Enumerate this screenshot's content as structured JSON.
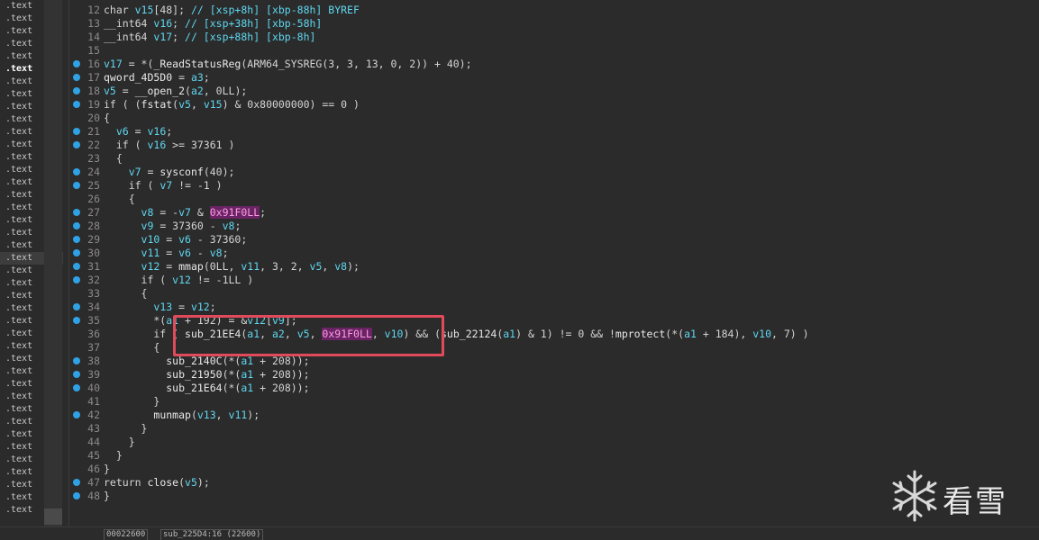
{
  "segments": [
    ".text",
    ".text",
    ".text",
    ".text",
    ".text",
    ".text",
    ".text",
    ".text",
    ".text",
    ".text",
    ".text",
    ".text",
    ".text",
    ".text",
    ".text",
    ".text",
    ".text",
    ".text",
    ".text",
    ".text",
    ".text",
    ".text",
    ".text",
    ".text",
    ".text",
    ".text",
    ".text",
    ".text",
    ".text",
    ".text",
    ".text",
    ".text",
    ".text",
    ".text",
    ".text",
    ".text",
    ".text",
    ".text",
    ".text",
    ".text",
    ".text"
  ],
  "code_lines": [
    {
      "n": "12",
      "bp": false,
      "tokens": [
        [
          "kw",
          "char "
        ],
        [
          "ident",
          "v15"
        ],
        [
          "kw",
          "[48]; "
        ],
        [
          "cmt",
          "// [xsp+8h] [xbp-88h] BYREF"
        ]
      ]
    },
    {
      "n": "13",
      "bp": false,
      "tokens": [
        [
          "kw",
          "__int64 "
        ],
        [
          "ident",
          "v16"
        ],
        [
          "kw",
          "; "
        ],
        [
          "cmt",
          "// [xsp+38h] [xbp-58h]"
        ]
      ]
    },
    {
      "n": "14",
      "bp": false,
      "tokens": [
        [
          "kw",
          "__int64 "
        ],
        [
          "ident",
          "v17"
        ],
        [
          "kw",
          "; "
        ],
        [
          "cmt",
          "// [xsp+88h] [xbp-8h]"
        ]
      ]
    },
    {
      "n": "15",
      "bp": false,
      "tokens": []
    },
    {
      "n": "16",
      "bp": true,
      "tokens": [
        [
          "ident",
          "v17"
        ],
        [
          "kw",
          " = *("
        ],
        [
          "func",
          "_ReadStatusReg"
        ],
        [
          "kw",
          "(ARM64_SYSREG(3, 3, 13, 0, 2)) + 40);"
        ]
      ]
    },
    {
      "n": "17",
      "bp": true,
      "tokens": [
        [
          "func",
          "qword_4D5D0"
        ],
        [
          "kw",
          " = "
        ],
        [
          "ident",
          "a3"
        ],
        [
          "kw",
          ";"
        ]
      ]
    },
    {
      "n": "18",
      "bp": true,
      "tokens": [
        [
          "ident",
          "v5"
        ],
        [
          "kw",
          " = "
        ],
        [
          "func",
          "__open_2"
        ],
        [
          "kw",
          "("
        ],
        [
          "ident",
          "a2"
        ],
        [
          "kw",
          ", 0LL);"
        ]
      ]
    },
    {
      "n": "19",
      "bp": true,
      "tokens": [
        [
          "kw",
          "if ( ("
        ],
        [
          "func",
          "fstat"
        ],
        [
          "kw",
          "("
        ],
        [
          "ident",
          "v5"
        ],
        [
          "kw",
          ", "
        ],
        [
          "ident",
          "v15"
        ],
        [
          "kw",
          ") & 0x80000000) == 0 )"
        ]
      ]
    },
    {
      "n": "20",
      "bp": false,
      "tokens": [
        [
          "kw",
          "{"
        ]
      ]
    },
    {
      "n": "21",
      "bp": true,
      "tokens": [
        [
          "kw",
          "  "
        ],
        [
          "ident",
          "v6"
        ],
        [
          "kw",
          " = "
        ],
        [
          "ident",
          "v16"
        ],
        [
          "kw",
          ";"
        ]
      ]
    },
    {
      "n": "22",
      "bp": true,
      "tokens": [
        [
          "kw",
          "  if ( "
        ],
        [
          "ident",
          "v16"
        ],
        [
          "kw",
          " >= 37361 )"
        ]
      ]
    },
    {
      "n": "23",
      "bp": false,
      "tokens": [
        [
          "kw",
          "  {"
        ]
      ]
    },
    {
      "n": "24",
      "bp": true,
      "tokens": [
        [
          "kw",
          "    "
        ],
        [
          "ident",
          "v7"
        ],
        [
          "kw",
          " = "
        ],
        [
          "func",
          "sysconf"
        ],
        [
          "kw",
          "(40);"
        ]
      ]
    },
    {
      "n": "25",
      "bp": true,
      "tokens": [
        [
          "kw",
          "    if ( "
        ],
        [
          "ident",
          "v7"
        ],
        [
          "kw",
          " != -1 )"
        ]
      ]
    },
    {
      "n": "26",
      "bp": false,
      "tokens": [
        [
          "kw",
          "    {"
        ]
      ]
    },
    {
      "n": "27",
      "bp": true,
      "tokens": [
        [
          "kw",
          "      "
        ],
        [
          "ident",
          "v8"
        ],
        [
          "kw",
          " = -"
        ],
        [
          "ident",
          "v7"
        ],
        [
          "kw",
          " & "
        ],
        [
          "hexnum",
          "0x91F0LL"
        ],
        [
          "kw",
          ";"
        ]
      ]
    },
    {
      "n": "28",
      "bp": true,
      "tokens": [
        [
          "kw",
          "      "
        ],
        [
          "ident",
          "v9"
        ],
        [
          "kw",
          " = 37360 - "
        ],
        [
          "ident",
          "v8"
        ],
        [
          "kw",
          ";"
        ]
      ]
    },
    {
      "n": "29",
      "bp": true,
      "tokens": [
        [
          "kw",
          "      "
        ],
        [
          "ident",
          "v10"
        ],
        [
          "kw",
          " = "
        ],
        [
          "ident",
          "v6"
        ],
        [
          "kw",
          " - 37360;"
        ]
      ]
    },
    {
      "n": "30",
      "bp": true,
      "tokens": [
        [
          "kw",
          "      "
        ],
        [
          "ident",
          "v11"
        ],
        [
          "kw",
          " = "
        ],
        [
          "ident",
          "v6"
        ],
        [
          "kw",
          " - "
        ],
        [
          "ident",
          "v8"
        ],
        [
          "kw",
          ";"
        ]
      ]
    },
    {
      "n": "31",
      "bp": true,
      "tokens": [
        [
          "kw",
          "      "
        ],
        [
          "ident",
          "v12"
        ],
        [
          "kw",
          " = "
        ],
        [
          "func",
          "mmap"
        ],
        [
          "kw",
          "(0LL, "
        ],
        [
          "ident",
          "v11"
        ],
        [
          "kw",
          ", 3, 2, "
        ],
        [
          "ident",
          "v5"
        ],
        [
          "kw",
          ", "
        ],
        [
          "ident",
          "v8"
        ],
        [
          "kw",
          ");"
        ]
      ]
    },
    {
      "n": "32",
      "bp": true,
      "tokens": [
        [
          "kw",
          "      if ( "
        ],
        [
          "ident",
          "v12"
        ],
        [
          "kw",
          " != -1LL )"
        ]
      ]
    },
    {
      "n": "33",
      "bp": false,
      "tokens": [
        [
          "kw",
          "      {"
        ]
      ]
    },
    {
      "n": "34",
      "bp": true,
      "tokens": [
        [
          "kw",
          "        "
        ],
        [
          "ident",
          "v13"
        ],
        [
          "kw",
          " = "
        ],
        [
          "ident",
          "v12"
        ],
        [
          "kw",
          ";"
        ]
      ]
    },
    {
      "n": "35",
      "bp": true,
      "tokens": [
        [
          "kw",
          "        *("
        ],
        [
          "ident",
          "a1"
        ],
        [
          "kw",
          " + 192) = &"
        ],
        [
          "ident",
          "v12"
        ],
        [
          "kw",
          "["
        ],
        [
          "ident",
          "v9"
        ],
        [
          "kw",
          "];"
        ]
      ]
    },
    {
      "n": "36",
      "bp": false,
      "tokens": [
        [
          "kw",
          "        if ( "
        ],
        [
          "func",
          "sub_21EE4"
        ],
        [
          "kw",
          "("
        ],
        [
          "ident",
          "a1"
        ],
        [
          "kw",
          ", "
        ],
        [
          "ident",
          "a2"
        ],
        [
          "kw",
          ", "
        ],
        [
          "ident",
          "v5"
        ],
        [
          "kw",
          ", "
        ],
        [
          "hexnum",
          "0x91F0LL"
        ],
        [
          "kw",
          ", "
        ],
        [
          "ident",
          "v10"
        ],
        [
          "kw",
          ") && ("
        ],
        [
          "func",
          "sub_22124"
        ],
        [
          "kw",
          "("
        ],
        [
          "ident",
          "a1"
        ],
        [
          "kw",
          ") & 1) != 0 && !"
        ],
        [
          "func",
          "mprotect"
        ],
        [
          "kw",
          "(*("
        ],
        [
          "ident",
          "a1"
        ],
        [
          "kw",
          " + 184), "
        ],
        [
          "ident",
          "v10"
        ],
        [
          "kw",
          ", 7) )"
        ]
      ]
    },
    {
      "n": "37",
      "bp": false,
      "tokens": [
        [
          "kw",
          "        {"
        ]
      ]
    },
    {
      "n": "38",
      "bp": true,
      "tokens": [
        [
          "kw",
          "          "
        ],
        [
          "func",
          "sub_2140C"
        ],
        [
          "kw",
          "(*("
        ],
        [
          "ident",
          "a1"
        ],
        [
          "kw",
          " + 208));"
        ]
      ]
    },
    {
      "n": "39",
      "bp": true,
      "tokens": [
        [
          "kw",
          "          "
        ],
        [
          "func",
          "sub_21950"
        ],
        [
          "kw",
          "(*("
        ],
        [
          "ident",
          "a1"
        ],
        [
          "kw",
          " + 208));"
        ]
      ]
    },
    {
      "n": "40",
      "bp": true,
      "tokens": [
        [
          "kw",
          "          "
        ],
        [
          "func",
          "sub_21E64"
        ],
        [
          "kw",
          "(*("
        ],
        [
          "ident",
          "a1"
        ],
        [
          "kw",
          " + 208));"
        ]
      ]
    },
    {
      "n": "41",
      "bp": false,
      "tokens": [
        [
          "kw",
          "        }"
        ]
      ]
    },
    {
      "n": "42",
      "bp": true,
      "tokens": [
        [
          "kw",
          "        "
        ],
        [
          "func",
          "munmap"
        ],
        [
          "kw",
          "("
        ],
        [
          "ident",
          "v13"
        ],
        [
          "kw",
          ", "
        ],
        [
          "ident",
          "v11"
        ],
        [
          "kw",
          ");"
        ]
      ]
    },
    {
      "n": "43",
      "bp": false,
      "tokens": [
        [
          "kw",
          "      }"
        ]
      ]
    },
    {
      "n": "44",
      "bp": false,
      "tokens": [
        [
          "kw",
          "    }"
        ]
      ]
    },
    {
      "n": "45",
      "bp": false,
      "tokens": [
        [
          "kw",
          "  }"
        ]
      ]
    },
    {
      "n": "46",
      "bp": false,
      "tokens": [
        [
          "kw",
          "}"
        ]
      ]
    },
    {
      "n": "47",
      "bp": true,
      "tokens": [
        [
          "kw",
          "return "
        ],
        [
          "func",
          "close"
        ],
        [
          "kw",
          "("
        ],
        [
          "ident",
          "v5"
        ],
        [
          "kw",
          ");"
        ]
      ]
    },
    {
      "n": "48",
      "bp": true,
      "tokens": [
        [
          "kw",
          "}"
        ]
      ]
    }
  ],
  "status": {
    "address": "00022600",
    "function": "sub_225D4:16 (22600)"
  },
  "watermark": {
    "text": "看雪"
  },
  "colors": {
    "breakpoint": "#2fa2e6",
    "highlight_box": "#e04a5a",
    "identifier": "#5fd7f0"
  }
}
